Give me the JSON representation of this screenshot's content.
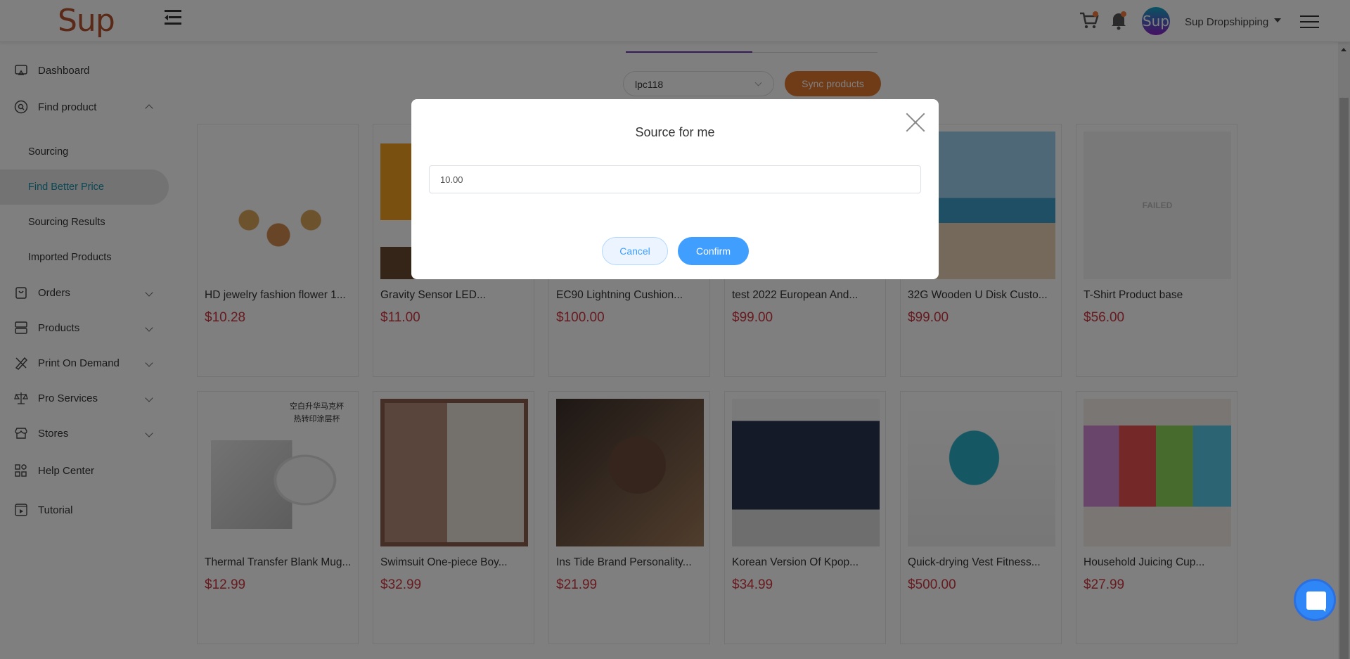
{
  "header": {
    "logo": "Sup",
    "avatar_text": "Sup",
    "user_name": "Sup Dropshipping",
    "icons": [
      "menu-collapse-icon",
      "cart-icon",
      "bell-icon",
      "hamburger-menu-icon"
    ]
  },
  "sidebar": {
    "items": [
      {
        "label": "Dashboard",
        "icon": "dashboard-icon"
      },
      {
        "label": "Find product",
        "icon": "search-icon",
        "expanded": true
      },
      {
        "label": "Orders",
        "icon": "shopping-bag-icon"
      },
      {
        "label": "Products",
        "icon": "server-stack-icon"
      },
      {
        "label": "Print On Demand",
        "icon": "pencil-ruler-icon"
      },
      {
        "label": "Pro Services",
        "icon": "scale-icon"
      },
      {
        "label": "Stores",
        "icon": "store-icon"
      },
      {
        "label": "Help Center",
        "icon": "grid-icon"
      },
      {
        "label": "Tutorial",
        "icon": "video-icon"
      }
    ],
    "sub_items": [
      {
        "label": "Sourcing"
      },
      {
        "label": "Find Better Price",
        "active": true
      },
      {
        "label": "Sourcing Results"
      },
      {
        "label": "Imported Products"
      }
    ]
  },
  "toolbar": {
    "store_select_value": "lpc118",
    "sync_label": "Sync products"
  },
  "products": [
    {
      "title": "HD jewelry fashion flower 1...",
      "price": "$10.28",
      "image": "jewelry"
    },
    {
      "title": "Gravity Sensor LED...",
      "price": "$11.00",
      "image": "bulb"
    },
    {
      "title": "EC90 Lightning Cushion...",
      "price": "$100.00",
      "image": "cushion"
    },
    {
      "title": "test 2022 European And...",
      "price": "$99.00",
      "image": "fashion"
    },
    {
      "title": "32G Wooden U Disk Custo...",
      "price": "$99.00",
      "image": "bikini"
    },
    {
      "title": "T-Shirt Product base",
      "price": "$56.00",
      "image": "failed",
      "image_text": "FAILED"
    },
    {
      "title": "Thermal Transfer Blank Mug...",
      "price": "$12.99",
      "image": "mug",
      "image_text": "空白升华马克杯\n热转印涂层杯"
    },
    {
      "title": "Swimsuit One-piece Boy...",
      "price": "$32.99",
      "image": "kids-clothes"
    },
    {
      "title": "Ins Tide Brand Personality...",
      "price": "$21.99",
      "image": "keychain"
    },
    {
      "title": "Korean Version Of Kpop...",
      "price": "$34.99",
      "image": "kpop"
    },
    {
      "title": "Quick-drying Vest Fitness...",
      "price": "$500.00",
      "image": "vest"
    },
    {
      "title": "Household Juicing Cup...",
      "price": "$27.99",
      "image": "juicers"
    }
  ],
  "modal": {
    "title": "Source for me",
    "input_value": "10.00",
    "cancel_label": "Cancel",
    "confirm_label": "Confirm"
  },
  "colors": {
    "brand": "#b5522f",
    "accent_tab": "#6a35b8",
    "sync_button": "#e0772f",
    "price": "#d0343e",
    "confirm": "#409eff",
    "active_nav": "#148fa8"
  }
}
